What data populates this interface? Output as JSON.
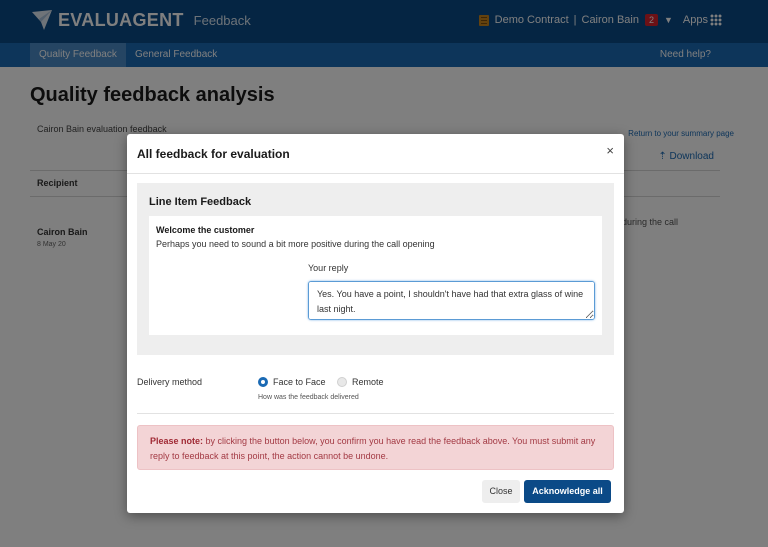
{
  "header": {
    "brand": "EVALUAGENT",
    "product": "Feedback",
    "contract": "Demo Contract",
    "separator": "|",
    "user": "Cairon Bain",
    "notifications": "2",
    "apps": "Apps",
    "brand_color": "#0b4a87",
    "contract_icon": "contract-icon"
  },
  "nav": {
    "tabs": [
      {
        "label": "Quality Feedback",
        "active": true
      },
      {
        "label": "General Feedback",
        "active": false
      }
    ],
    "help": "Need help?",
    "nav_color": "#1b6ab4"
  },
  "page": {
    "title": "Quality feedback analysis",
    "evaluation_label": "Cairon Bain evaluation feedback",
    "return_link": "Return to your summary page",
    "download": "Download",
    "column_recipient": "Recipient",
    "row": {
      "name": "Cairon Bain",
      "date": "8 May 20",
      "tail_text": "during the call"
    }
  },
  "modal": {
    "title": "All feedback for evaluation",
    "close": "×",
    "section_title": "Line Item Feedback",
    "item_heading": "Welcome the customer",
    "item_text": "Perhaps you need to sound a bit more positive during the call opening",
    "reply_label": "Your reply",
    "reply_value": "Yes. You have a point, I shouldn't have had that extra glass of wine last night.",
    "delivery_label": "Delivery method",
    "delivery_options": [
      {
        "label": "Face to Face",
        "selected": true
      },
      {
        "label": "Remote",
        "selected": false
      }
    ],
    "delivery_hint": "How was the feedback delivered",
    "alert_strong": "Please note:",
    "alert_text": " by clicking the button below, you confirm you have read the feedback above. You must submit any reply to feedback at this point, the action cannot be undone.",
    "btn_close": "Close",
    "btn_acknowledge": "Acknowledge all"
  }
}
